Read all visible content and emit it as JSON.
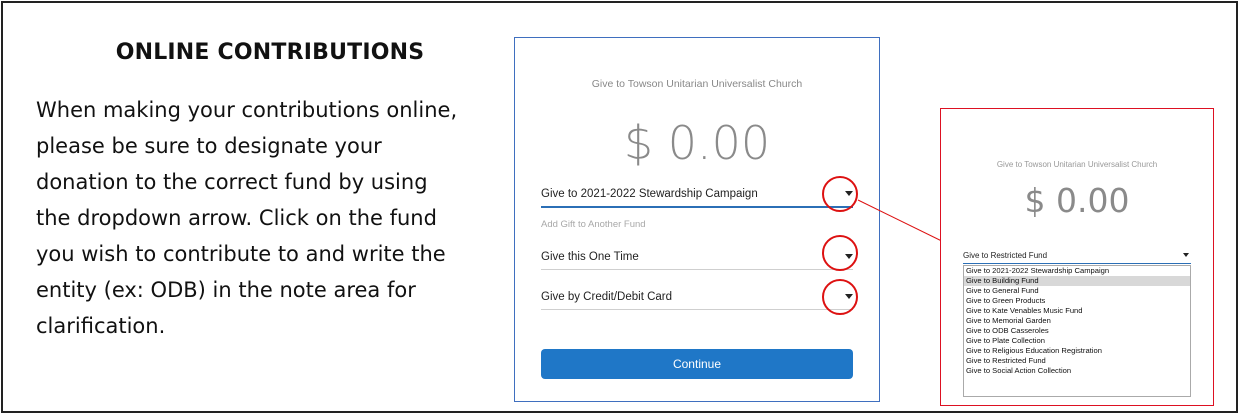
{
  "heading": "ONLINE CONTRIBUTIONS",
  "instructions": "When making your contributions online,\nplease be sure to designate your\ndonation to the correct fund by using\nthe dropdown arrow. Click on the fund\nyou wish to contribute to and write the\nentity (ex: ODB) in the note area for\nclarification.",
  "form": {
    "org": "Give to Towson Unitarian Universalist Church",
    "amount": "$ 0.00",
    "fund_select": "Give to 2021-2022 Stewardship Campaign",
    "add_gift": "Add Gift to Another Fund",
    "frequency_select": "Give this One Time",
    "payment_select": "Give by Credit/Debit Card",
    "continue_label": "Continue"
  },
  "inset": {
    "org": "Give to Towson Unitarian Universalist Church",
    "amount": "$ 0.00",
    "selected": "Give to Restricted Fund",
    "options": [
      "Give to 2021-2022 Stewardship Campaign",
      "Give to Building Fund",
      "Give to General Fund",
      "Give to Green Products",
      "Give to Kate Venables Music Fund",
      "Give to Memorial Garden",
      "Give to ODB Casseroles",
      "Give to Plate Collection",
      "Give to Religious Education Registration",
      "Give to Restricted Fund",
      "Give to Social Action Collection"
    ],
    "highlighted_option": "Give to Building Fund"
  },
  "colors": {
    "accent": "#1f77c7",
    "annotation": "#dd1111",
    "form_border": "#3f6fbf"
  }
}
